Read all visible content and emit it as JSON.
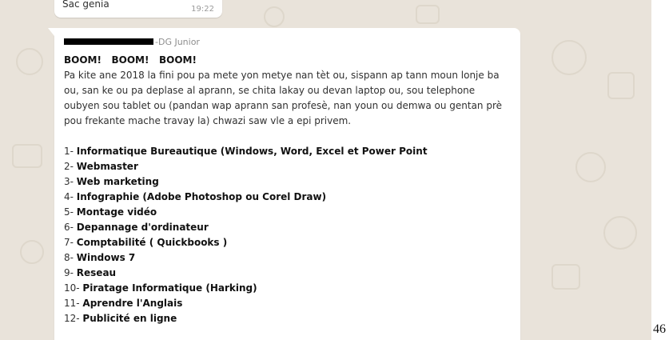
{
  "previous_message": {
    "text": "Sac genia",
    "time": "19:22"
  },
  "message": {
    "sender": "-DG Junior",
    "headline": "BOOM!   BOOM!   BOOM!",
    "intro_lines": [
      "Pa kite ane 2018 la fini pou pa mete yon metye nan tèt ou, sispann ap tann moun lonje ba",
      "ou, san ke ou pa deplase al aprann, se chita lakay ou devan laptop ou, sou telephone",
      "oubyen sou tablet ou (pandan wap aprann san profesè, nan youn ou demwa ou gentan prè",
      "pou frekante mache travay la) chwazi saw vle a epi privem."
    ],
    "courses": [
      {
        "num": "1- ",
        "name": "Informatique Bureautique (Windows, Word, Excel et Power Point"
      },
      {
        "num": "2- ",
        "name": "Webmaster"
      },
      {
        "num": "3- ",
        "name": "Web marketing"
      },
      {
        "num": "4- ",
        "name": "Infographie (Adobe Photoshop ou Corel Draw)"
      },
      {
        "num": "5- ",
        "name": "Montage vidéo"
      },
      {
        "num": "6- ",
        "name": "Depannage d'ordinateur"
      },
      {
        "num": "7- ",
        "name": "Comptabilité ( Quickbooks )"
      },
      {
        "num": "8- ",
        "name": "Windows 7"
      },
      {
        "num": "9- ",
        "name": "Reseau"
      },
      {
        "num": "10- ",
        "name": "Piratage Informatique (Harking)"
      },
      {
        "num": "11- ",
        "name": "Aprendre l'Anglais"
      },
      {
        "num": "12- ",
        "name": "Publicité en ligne"
      }
    ]
  },
  "page_number": "46",
  "colors": {
    "chat_background": "#e9e3da",
    "bubble": "#ffffff",
    "sender": "#8d8d8d",
    "text": "#303030"
  }
}
